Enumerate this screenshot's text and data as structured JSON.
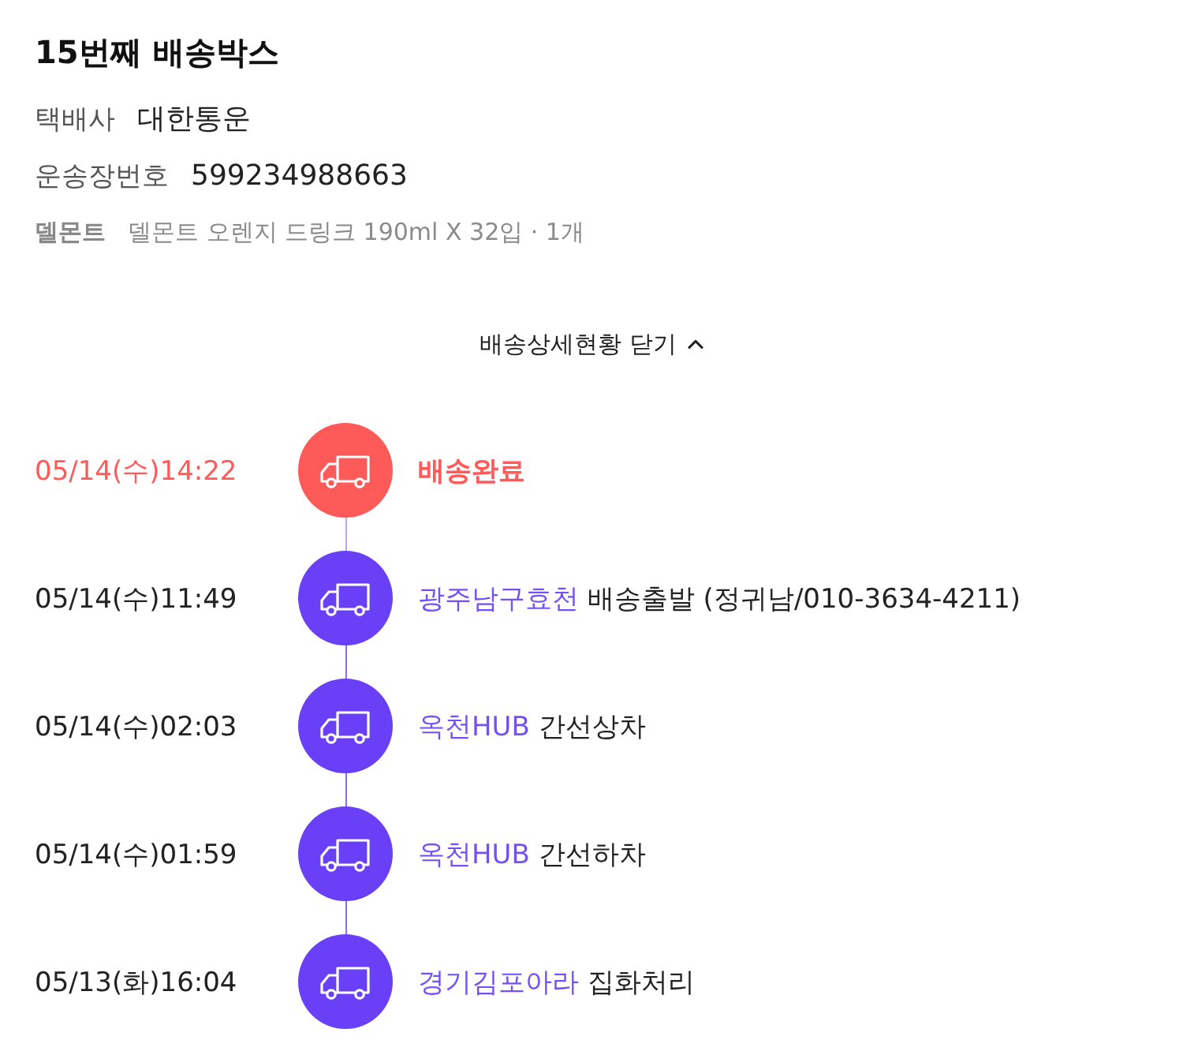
{
  "box": {
    "title": "15번째 배송박스"
  },
  "fields": [
    {
      "label": "택배사",
      "value": "대한통운"
    },
    {
      "label": "운송장번호",
      "value": "599234988663"
    }
  ],
  "product": {
    "brand": "델몬트",
    "option": "델몬트 오렌지 드링크 190ml X 32입 · 1개"
  },
  "detail_toggle": {
    "label": "배송상세현황 닫기",
    "expanded": true
  },
  "events": [
    {
      "kind": "delivered",
      "time": "05/14(수)14:22",
      "status": "배송완료"
    },
    {
      "kind": "transit",
      "time": "05/14(수)11:49",
      "location": "광주남구효천",
      "status": "배송출발 (정귀남/010-3634-4211)"
    },
    {
      "kind": "transit",
      "time": "05/14(수)02:03",
      "location": "옥천HUB",
      "status": "간선상차"
    },
    {
      "kind": "transit",
      "time": "05/14(수)01:59",
      "location": "옥천HUB",
      "status": "간선하차"
    },
    {
      "kind": "transit",
      "time": "05/13(화)16:04",
      "location": "경기김포아라",
      "status": "집화처리"
    }
  ]
}
